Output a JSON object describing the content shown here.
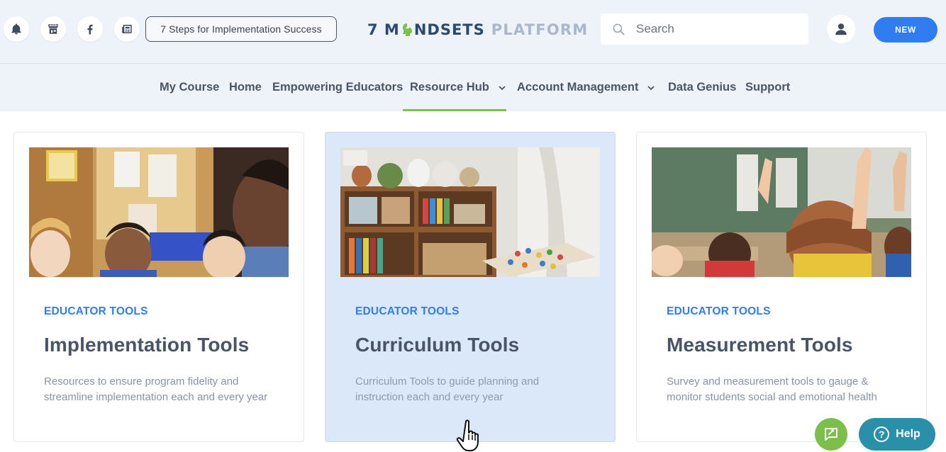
{
  "header": {
    "icons": [
      "bell-icon",
      "store-icon",
      "facebook-icon",
      "newspaper-icon"
    ],
    "steps_button": "7 Steps for Implementation Success",
    "logo": {
      "part1": "7 M",
      "part2": "NDSETS",
      "part3": "PLATFORM"
    },
    "search": {
      "placeholder": "Search",
      "value": ""
    },
    "new_button": "NEW"
  },
  "nav": {
    "items": [
      {
        "label": "My Course"
      },
      {
        "label": "Home"
      },
      {
        "label": "Empowering Educators"
      },
      {
        "label": "Resource Hub",
        "has_dropdown": true,
        "active": true
      },
      {
        "label": "Account Management",
        "has_dropdown": true
      },
      {
        "label": "Data Genius"
      },
      {
        "label": "Support"
      }
    ]
  },
  "cards": [
    {
      "tag": "EDUCATOR TOOLS",
      "title": "Implementation Tools",
      "description": "Resources to ensure program fidelity and streamline implementation each and every year"
    },
    {
      "tag": "EDUCATOR TOOLS",
      "title": "Curriculum Tools",
      "description": "Curriculum Tools to guide planning and instruction each and every year",
      "hovered": true
    },
    {
      "tag": "EDUCATOR TOOLS",
      "title": "Measurement Tools",
      "description": "Survey and measurement tools to gauge & monitor students social and emotional health"
    }
  ],
  "floating": {
    "chat_icon": "chat-icon",
    "help_button": "Help"
  },
  "colors": {
    "accent_blue": "#2f7df0",
    "accent_green": "#7cc04b",
    "help_teal": "#2a8fa8",
    "header_bg": "#eef2f9",
    "logo_navy": "#2b4a72"
  }
}
